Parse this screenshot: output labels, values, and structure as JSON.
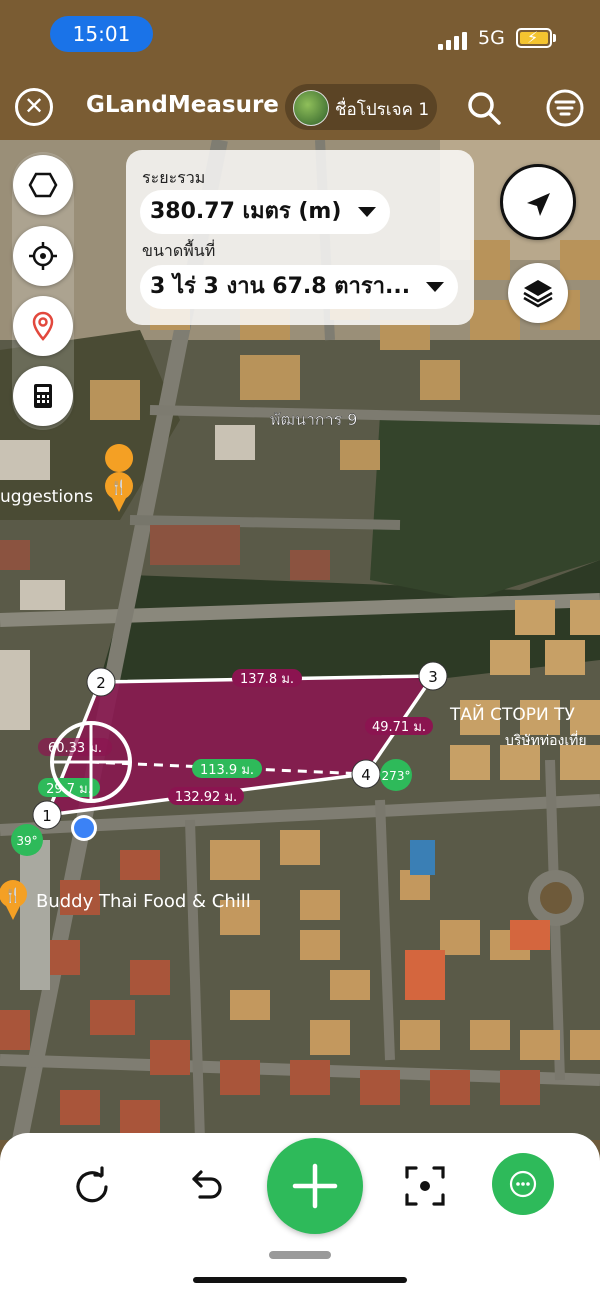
{
  "status_bar": {
    "time": "15:01",
    "network": "5G",
    "battery_charging": true
  },
  "app_bar": {
    "title": "GLandMeasure",
    "project_name": "ชื่อโปรเจค 1"
  },
  "info_panel": {
    "distance_label": "ระยะรวม",
    "distance_value": "380.77 เมตร (m)",
    "area_label": "ขนาดพื้นที่",
    "area_value": "3 ไร่ 3 งาน 67.8 ตารา..."
  },
  "map": {
    "road_label": "พัฒนาการ 9",
    "place_label_1": "uggestions",
    "place_label_2": "Buddy Thai Food & Chill",
    "place_label_3": "ТАЙ СТОРИ ТУ",
    "place_label_4": "บริษัทท่องเที่ย",
    "points": [
      "1",
      "2",
      "3",
      "4"
    ],
    "edge_1_2": "60.33 ม.",
    "edge_2_3": "137.8 ม.",
    "edge_3_4": "49.71 ม.",
    "edge_4_1": "132.92 ม.",
    "dashed_length": "113.9 ม.",
    "segment_from_1": "29.7 ม.",
    "angle_4": "273°",
    "angle_1": "39°",
    "polygon_color": "#8b1450",
    "accent_green": "#2eba5a"
  },
  "icons": {
    "close": "close-icon",
    "search": "search-icon",
    "menu": "menu-icon",
    "polygon_tool": "polygon-icon",
    "locate_tool": "crosshair-icon",
    "pin_tool": "location-pin-icon",
    "calculator_tool": "calculator-icon",
    "navigate": "navigation-arrow-icon",
    "layers": "layers-icon",
    "redo": "redo-icon",
    "undo": "undo-icon",
    "add": "plus-icon",
    "focus": "focus-icon",
    "more": "more-icon"
  }
}
